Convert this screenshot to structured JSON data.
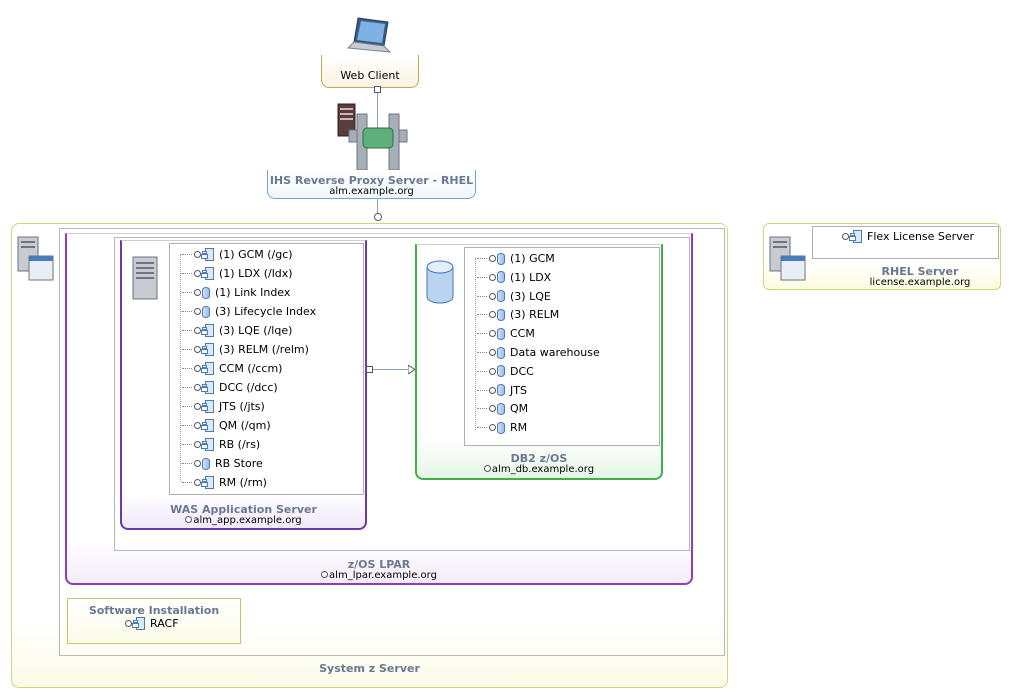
{
  "web_client": {
    "label": "Web Client"
  },
  "proxy": {
    "title": "IHS Reverse Proxy Server - RHEL",
    "host": "alm.example.org"
  },
  "system_z": {
    "title": "System z Server"
  },
  "zos_lpar": {
    "title": "z/OS LPAR",
    "host": "alm_lpar.example.org"
  },
  "was": {
    "title": "WAS Application Server",
    "host": "alm_app.example.org",
    "items": [
      {
        "label": "(1) GCM (/gc)",
        "icon": "component-icon"
      },
      {
        "label": "(1) LDX (/ldx)",
        "icon": "component-icon"
      },
      {
        "label": "(1) Link Index",
        "icon": "database-icon"
      },
      {
        "label": "(3) Lifecycle Index",
        "icon": "database-icon"
      },
      {
        "label": "(3) LQE (/lqe)",
        "icon": "component-icon"
      },
      {
        "label": "(3) RELM (/relm)",
        "icon": "component-icon"
      },
      {
        "label": "CCM (/ccm)",
        "icon": "component-icon"
      },
      {
        "label": "DCC (/dcc)",
        "icon": "component-icon"
      },
      {
        "label": "JTS (/jts)",
        "icon": "component-icon"
      },
      {
        "label": "QM (/qm)",
        "icon": "component-icon"
      },
      {
        "label": "RB (/rs)",
        "icon": "component-icon"
      },
      {
        "label": "RB Store",
        "icon": "database-icon"
      },
      {
        "label": "RM (/rm)",
        "icon": "component-icon"
      }
    ]
  },
  "db2": {
    "title": "DB2 z/OS",
    "host": "alm_db.example.org",
    "items": [
      {
        "label": "(1) GCM"
      },
      {
        "label": "(1) LDX"
      },
      {
        "label": "(3) LQE"
      },
      {
        "label": "(3) RELM"
      },
      {
        "label": "CCM"
      },
      {
        "label": "Data warehouse"
      },
      {
        "label": "DCC"
      },
      {
        "label": "JTS"
      },
      {
        "label": "QM"
      },
      {
        "label": "RM"
      }
    ]
  },
  "software_installation": {
    "title": "Software Installation",
    "item": "RACF"
  },
  "rhel_server": {
    "title": "RHEL Server",
    "host": "license.example.org",
    "item": "Flex License Server"
  },
  "colors": {
    "web_client_border": "#c9a45a",
    "proxy_border": "#6fa7cf",
    "system_z_border": "#d6d37a",
    "lpar_border": "#8a3fb5",
    "was_border": "#6a3aa8",
    "db2_border": "#3fb04a",
    "rhel_border": "#d6d37a",
    "title_text": "#6b7893"
  }
}
